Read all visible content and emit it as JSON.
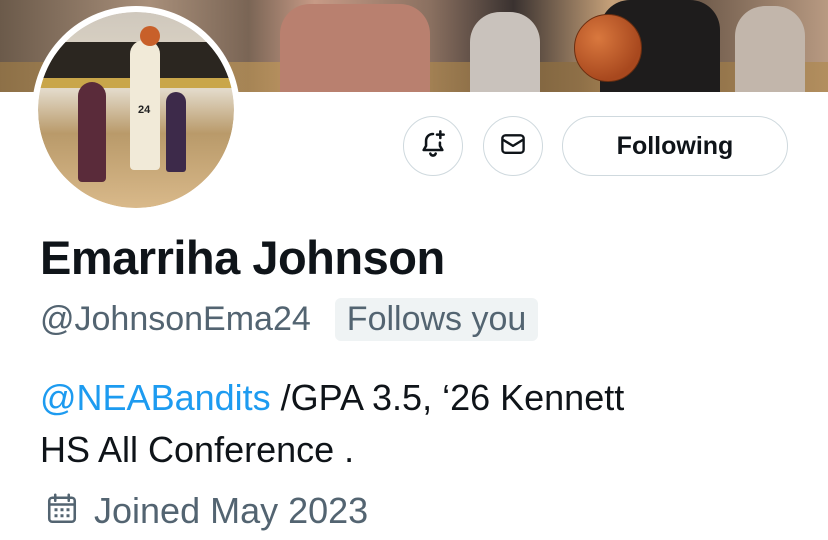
{
  "profile": {
    "name": "Emarriha Johnson",
    "handle": "@JohnsonEma24",
    "follows_you": "Follows you",
    "bio_mention": "@NEABandits",
    "bio_line1_rest": " /GPA 3.5, ‘26 Kennett",
    "bio_line2": "HS All Conference .",
    "joined": "Joined May 2023",
    "jersey_number": "24"
  },
  "actions": {
    "notify_icon": "bell-plus-icon",
    "message_icon": "envelope-icon",
    "following_label": "Following"
  },
  "colors": {
    "link": "#1d9bf0",
    "secondary_text": "#536471",
    "primary_text": "#0f1419",
    "border": "#cfd9de",
    "badge_bg": "#eff3f4"
  }
}
